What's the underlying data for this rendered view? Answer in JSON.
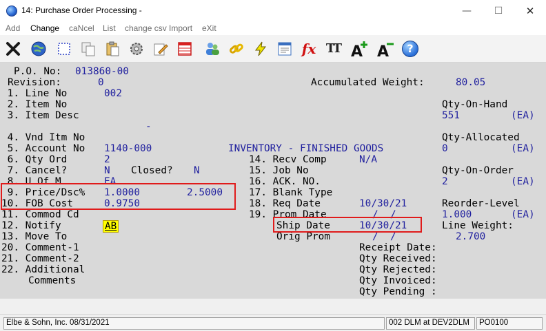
{
  "window": {
    "title": "14: Purchase Order Processing -",
    "minimize_glyph": "—",
    "maximize_glyph": "☐",
    "close_glyph": "✕"
  },
  "menu": {
    "items": [
      "Add",
      "Change",
      "caNcel",
      "List",
      "change csv Import",
      "eXit"
    ],
    "active": "Change"
  },
  "toolbar": {
    "icons": [
      "close-x-icon",
      "globe-icon",
      "select-icon",
      "copy-icon",
      "paste-icon",
      "settings-icon",
      "edit-icon",
      "table-icon",
      "users-icon",
      "link-icon",
      "lightning-icon",
      "report-icon",
      "function-icon",
      "font-size-icon",
      "increase-font-icon",
      "decrease-font-icon",
      "help-icon"
    ],
    "function_glyph": "fx",
    "font_glyph": "TT",
    "help_glyph": "?"
  },
  "po": {
    "po_label": "P.O. No:",
    "po_value": "013860-00",
    "revision_label": "Revision:",
    "revision_value": "0",
    "accumulated_weight_label": "Accumulated Weight:",
    "accumulated_weight_value": "80.05"
  },
  "fields": {
    "line_no": {
      "label": " 1. Line No",
      "value": "002"
    },
    "item_no": {
      "label": " 2. Item No",
      "value": ""
    },
    "item_desc": {
      "label": " 3. Item Desc",
      "value": "",
      "value2": "-"
    },
    "vnd_itm_no": {
      "label": " 4. Vnd Itm No",
      "value": ""
    },
    "account_no": {
      "label": " 5. Account No",
      "value": "1140-000",
      "desc": "INVENTORY - FINISHED GOODS"
    },
    "qty_ord": {
      "label": " 6. Qty Ord",
      "value": "2"
    },
    "cancel": {
      "label": " 7. Cancel?",
      "value": "N",
      "closed_label": "Closed?",
      "closed_value": "N"
    },
    "u_of_m": {
      "label": " 8. U Of M",
      "value": "EA"
    },
    "price_dsc": {
      "label": " 9. Price/Dsc%",
      "value": "1.0000",
      "discount": "2.5000"
    },
    "fob_cost": {
      "label": "10. FOB Cost",
      "value": "0.9750"
    },
    "commod_cd": {
      "label": "11. Commod Cd",
      "value": ""
    },
    "notify": {
      "label": "12. Notify",
      "value": "AB"
    },
    "move_to": {
      "label": "13. Move To",
      "value": ""
    },
    "recv_comp": {
      "label": "14. Recv Comp",
      "value": "N/A"
    },
    "job_no": {
      "label": "15. Job No",
      "value": ""
    },
    "ack_no": {
      "label": "16. ACK. NO.",
      "value": ""
    },
    "blank_type": {
      "label": "17. Blank Type",
      "value": ""
    },
    "req_date": {
      "label": "18. Req Date",
      "value": "10/30/21"
    },
    "prom_date": {
      "label": "19. Prom Date",
      "value": "/  /"
    },
    "ship_date": {
      "label": "Ship Date",
      "value": "10/30/21"
    },
    "orig_prom": {
      "label": "Orig Prom",
      "value": "/  /"
    },
    "comment1": {
      "label": "20. Comment-1",
      "value": ""
    },
    "comment2": {
      "label": "21. Comment-2",
      "value": ""
    },
    "additional": {
      "label": "22. Additional",
      "label2": "Comments",
      "value": ""
    }
  },
  "side": {
    "qty_on_hand_label": "Qty-On-Hand",
    "qty_on_hand_value": "551",
    "qty_on_hand_unit": "(EA)",
    "qty_allocated_label": "Qty-Allocated",
    "qty_allocated_value": "0",
    "qty_allocated_unit": "(EA)",
    "qty_on_order_label": "Qty-On-Order",
    "qty_on_order_value": "2",
    "qty_on_order_unit": "(EA)",
    "reorder_level_label": "Reorder-Level",
    "reorder_level_value": "1.000",
    "reorder_level_unit": "(EA)",
    "line_weight_label": "Line Weight:",
    "line_weight_value": "2.700"
  },
  "receipt": {
    "receipt_date_label": "Receipt Date:",
    "qty_received_label": "Qty Received:",
    "qty_rejected_label": "Qty Rejected:",
    "qty_invoiced_label": "Qty Invoiced:",
    "qty_pending_label": "Qty Pending :"
  },
  "status": {
    "company": "Elbe & Sohn, Inc. 08/31/2021",
    "session": "002 DLM at DEV2DLM",
    "program": "PO0100"
  },
  "colors": {
    "form_bg": "#d9d9d9",
    "value_blue": "#1f1f9e",
    "highlight_red": "#e01b1b",
    "notify_yellow": "#ffff00"
  }
}
